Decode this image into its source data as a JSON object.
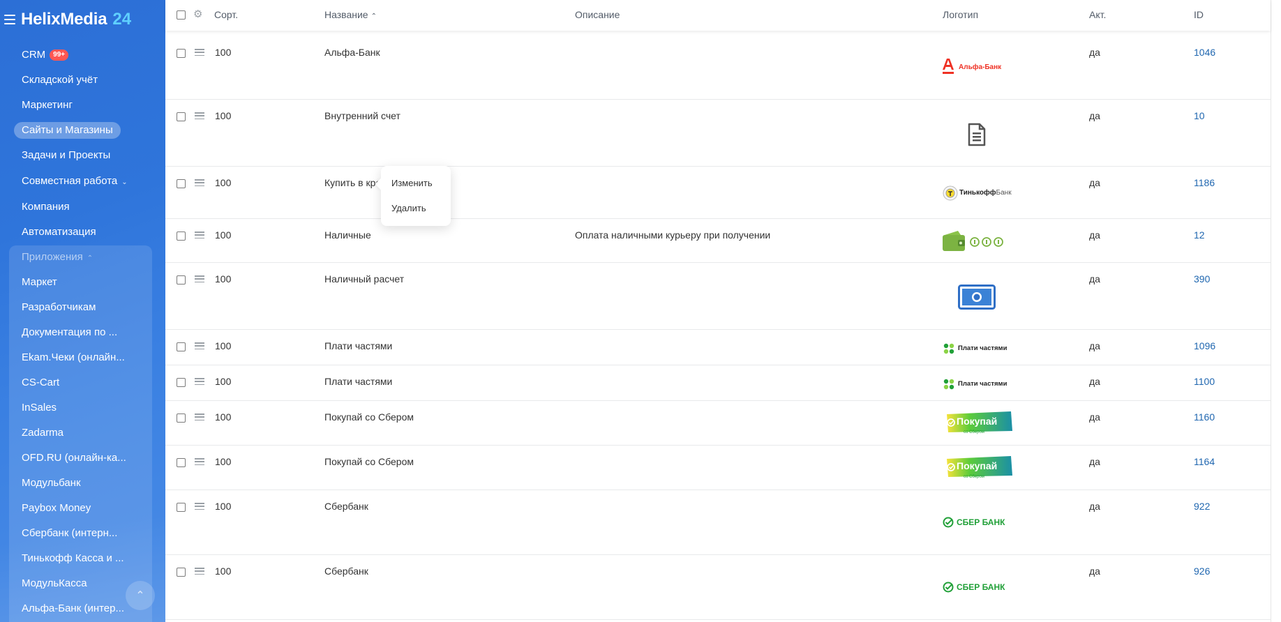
{
  "brand": {
    "name": "HelixMedia",
    "number": "24"
  },
  "sidebar": {
    "items": [
      {
        "label": "CRM",
        "badge": "99+"
      },
      {
        "label": "Складской учёт"
      },
      {
        "label": "Маркетинг"
      },
      {
        "label": "Сайты и Магазины",
        "active": true
      },
      {
        "label": "Задачи и Проекты"
      },
      {
        "label": "Совместная работа",
        "chevron": "chevron-down-icon"
      },
      {
        "label": "Компания"
      },
      {
        "label": "Автоматизация"
      },
      {
        "label": "Приложения",
        "chevron": "chevron-up-icon"
      },
      {
        "label": "Маркет"
      },
      {
        "label": "Разработчикам"
      },
      {
        "label": "Документация по ..."
      },
      {
        "label": "Ekam.Чеки (онлайн..."
      },
      {
        "label": "CS-Cart"
      },
      {
        "label": "InSales"
      },
      {
        "label": "Zadarma"
      },
      {
        "label": "OFD.RU (онлайн-ка..."
      },
      {
        "label": "Модульбанк"
      },
      {
        "label": "Paybox Money"
      },
      {
        "label": "Сбербанк (интерн..."
      },
      {
        "label": "Тинькофф Касса и ..."
      },
      {
        "label": "МодульКасса"
      },
      {
        "label": "Альфа-Банк (интер..."
      }
    ]
  },
  "table": {
    "columns": {
      "sort": "Сорт.",
      "name": "Название",
      "description": "Описание",
      "logo": "Логотип",
      "active": "Акт.",
      "id": "ID"
    },
    "rows": [
      {
        "sort": "100",
        "name": "Альфа-Банк",
        "description": "",
        "logo": "alfa-bank-logo",
        "active": "да",
        "id": "1046"
      },
      {
        "sort": "100",
        "name": "Внутренний счет",
        "description": "",
        "logo": "document-icon",
        "active": "да",
        "id": "10"
      },
      {
        "sort": "100",
        "name": "Купить в кредит",
        "description": "",
        "logo": "tinkoff-bank-logo",
        "active": "да",
        "id": "1186"
      },
      {
        "sort": "100",
        "name": "Наличные",
        "description": "Оплата наличными курьеру при получении",
        "logo": "cash-wallet-icon",
        "active": "да",
        "id": "12"
      },
      {
        "sort": "100",
        "name": "Наличный расчет",
        "description": "",
        "logo": "banknote-icon",
        "active": "да",
        "id": "390"
      },
      {
        "sort": "100",
        "name": "Плати частями",
        "description": "",
        "logo": "plati-chastyami-logo",
        "active": "да",
        "id": "1096"
      },
      {
        "sort": "100",
        "name": "Плати частями",
        "description": "",
        "logo": "plati-chastyami-logo",
        "active": "да",
        "id": "1100"
      },
      {
        "sort": "100",
        "name": "Покупай со Сбером",
        "description": "",
        "logo": "pokupay-so-sberom-logo",
        "active": "да",
        "id": "1160"
      },
      {
        "sort": "100",
        "name": "Покупай со Сбером",
        "description": "",
        "logo": "pokupay-so-sberom-logo",
        "active": "да",
        "id": "1164"
      },
      {
        "sort": "100",
        "name": "Сбербанк",
        "description": "",
        "logo": "sberbank-logo",
        "active": "да",
        "id": "922"
      },
      {
        "sort": "100",
        "name": "Сбербанк",
        "description": "",
        "logo": "sberbank-logo",
        "active": "да",
        "id": "926"
      }
    ]
  },
  "logos": {
    "alfa": "Альфа-Банк",
    "tinkoff": "Тинькофф",
    "tinkoff_suffix": "Банк",
    "plati": "Плати частями",
    "pokupay": "Покупай",
    "pokupay_sub": "со Сбером",
    "sber": "СБЕР БАНК"
  },
  "context_menu": {
    "edit": "Изменить",
    "delete": "Удалить"
  },
  "colors": {
    "sidebar": "#2f75db",
    "accent": "#5fd0ff",
    "link": "#2067b0",
    "badge": "#ff5752"
  }
}
